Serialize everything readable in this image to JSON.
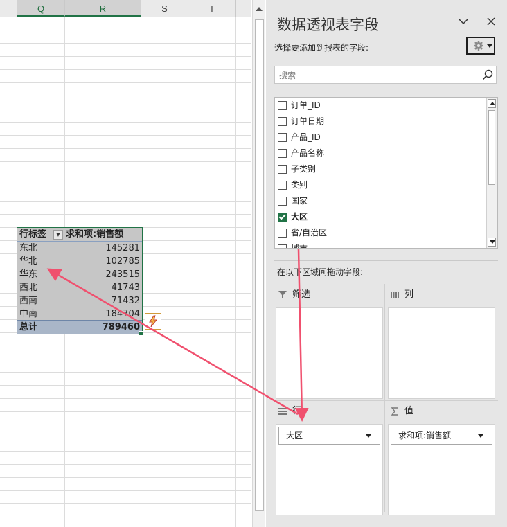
{
  "sheet": {
    "columns": [
      "Q",
      "R",
      "S",
      "T"
    ],
    "pivot": {
      "row_header": "行标签",
      "value_header": "求和项:销售额",
      "rows": [
        {
          "label": "东北",
          "value": "145281"
        },
        {
          "label": "华北",
          "value": "102785"
        },
        {
          "label": "华东",
          "value": "243515"
        },
        {
          "label": "西北",
          "value": "41743"
        },
        {
          "label": "西南",
          "value": "71432"
        },
        {
          "label": "中南",
          "value": "184704"
        }
      ],
      "total_label": "总计",
      "total_value": "789460"
    }
  },
  "panel": {
    "title": "数据透视表字段",
    "subtitle": "选择要添加到报表的字段:",
    "search_placeholder": "搜索",
    "fields": [
      {
        "label": "订单_ID",
        "checked": false
      },
      {
        "label": "订单日期",
        "checked": false
      },
      {
        "label": "产品_ID",
        "checked": false
      },
      {
        "label": "产品名称",
        "checked": false
      },
      {
        "label": "子类别",
        "checked": false
      },
      {
        "label": "类别",
        "checked": false
      },
      {
        "label": "国家",
        "checked": false
      },
      {
        "label": "大区",
        "checked": true
      },
      {
        "label": "省/自治区",
        "checked": false
      },
      {
        "label": "城市",
        "checked": false
      }
    ],
    "areas_label": "在以下区域间拖动字段:",
    "areas": {
      "filter": {
        "title": "筛选"
      },
      "columns": {
        "title": "列"
      },
      "rows": {
        "title": "行",
        "items": [
          "大区"
        ]
      },
      "values": {
        "title": "值",
        "items": [
          "求和项:销售额"
        ]
      }
    }
  },
  "colors": {
    "excel_green": "#217346",
    "annotation_arrow": "#f0506e"
  }
}
